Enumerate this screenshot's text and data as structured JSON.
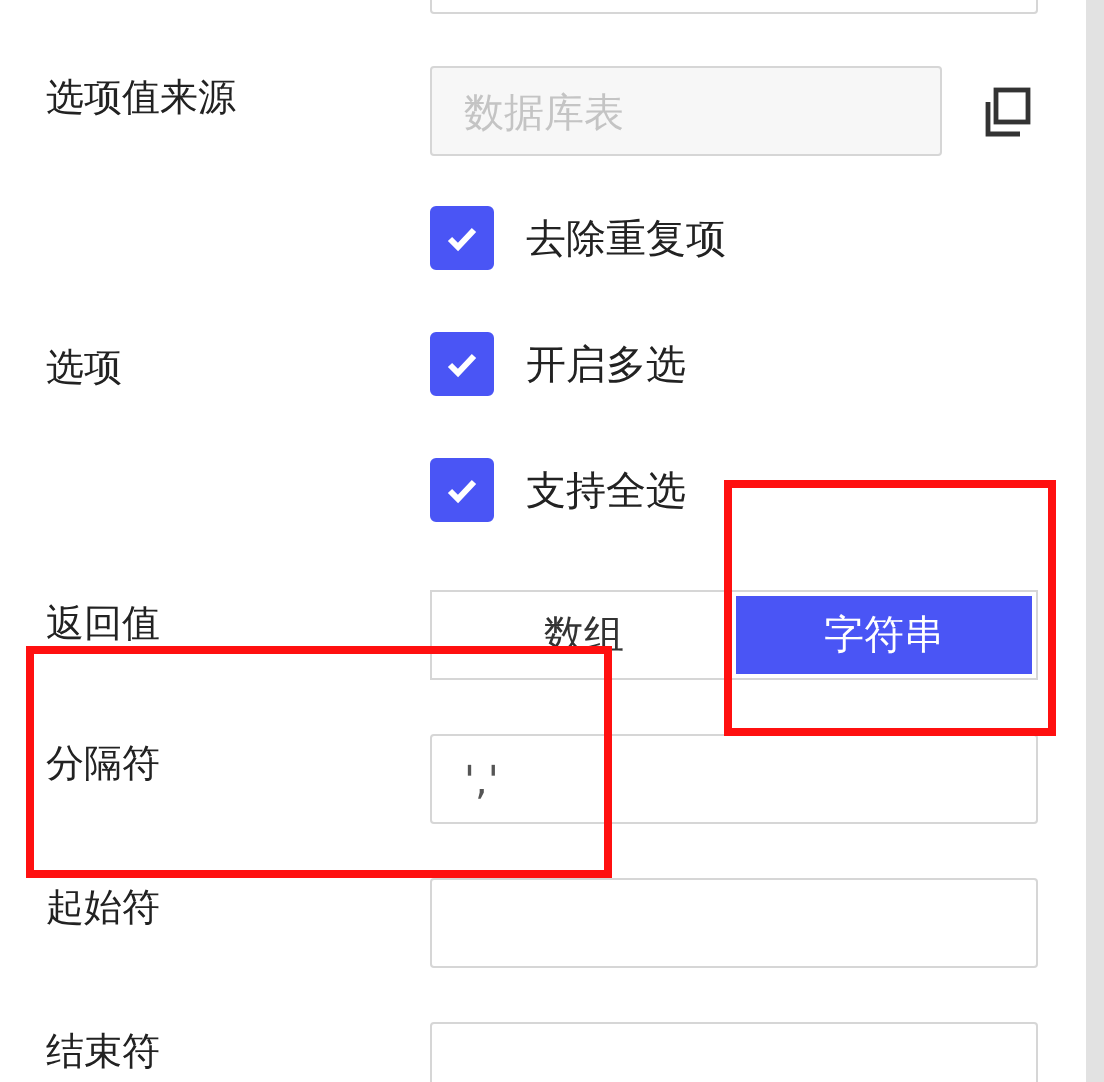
{
  "source": {
    "label": "选项值来源",
    "placeholder": "数据库表",
    "disabled": true
  },
  "options": {
    "label": "选项",
    "items": [
      {
        "label": "去除重复项",
        "checked": true
      },
      {
        "label": "开启多选",
        "checked": true
      },
      {
        "label": "支持全选",
        "checked": true
      }
    ]
  },
  "return_value": {
    "label": "返回值",
    "choices": [
      {
        "label": "数组",
        "selected": false
      },
      {
        "label": "字符串",
        "selected": true
      }
    ]
  },
  "fields": [
    {
      "label": "分隔符",
      "value": "','"
    },
    {
      "label": "起始符"
    },
    {
      "label": "结束符"
    }
  ],
  "annotation_frames": [
    {
      "kind": "rectangle"
    },
    {
      "kind": "rectangle"
    }
  ]
}
